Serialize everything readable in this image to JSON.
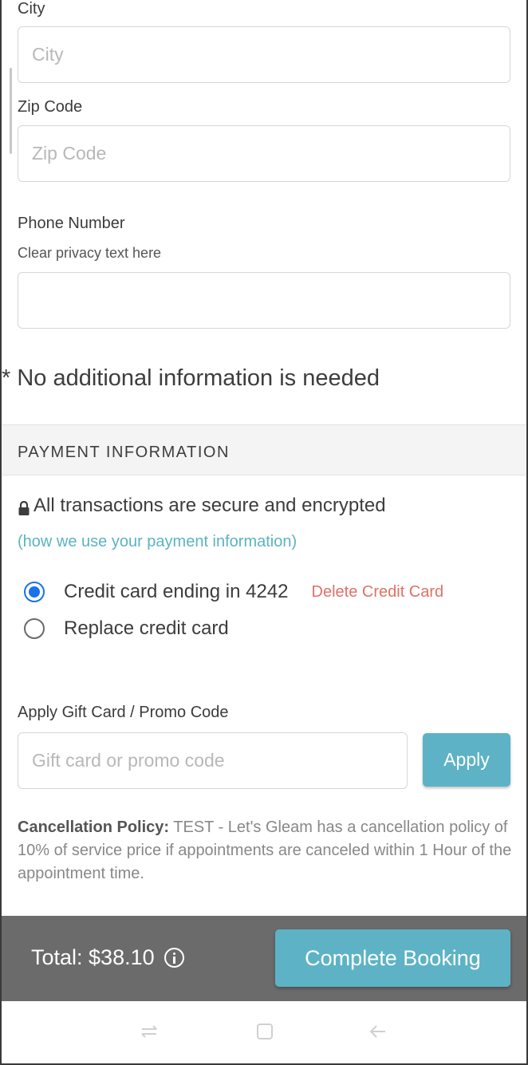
{
  "address": {
    "city_label": "City",
    "city_placeholder": "City",
    "zip_label": "Zip Code",
    "zip_placeholder": "Zip Code",
    "phone_label": "Phone Number",
    "phone_privacy_text": "Clear privacy text here",
    "phone_value": ""
  },
  "notice": "* No additional information is needed",
  "payment": {
    "section_title": "PAYMENT INFORMATION",
    "secure_text": "All transactions are secure and encrypted",
    "info_link": "(how we use your payment information)",
    "options": [
      {
        "label": "Credit card ending in 4242",
        "selected": true
      },
      {
        "label": "Replace credit card",
        "selected": false
      }
    ],
    "delete_card_label": "Delete Credit Card"
  },
  "promo": {
    "label": "Apply Gift Card / Promo Code",
    "placeholder": "Gift card or promo code",
    "apply_label": "Apply"
  },
  "policy": {
    "title": "Cancellation Policy:",
    "text": " TEST - Let's Gleam has a cancellation policy of 10% of service price if appointments are canceled within 1 Hour of the appointment time."
  },
  "footer": {
    "total_text": "Total: $38.10",
    "complete_label": "Complete Booking"
  },
  "colors": {
    "accent": "#5db3c5",
    "link": "#5bb3c3",
    "danger": "#e07166",
    "radio_selected": "#1a73e8",
    "footer_bg": "#6b6b6b"
  },
  "icons": {
    "lock": "lock-icon",
    "info": "info-icon",
    "nav_recent": "recent-apps-icon",
    "nav_home": "home-icon",
    "nav_back": "back-icon"
  }
}
